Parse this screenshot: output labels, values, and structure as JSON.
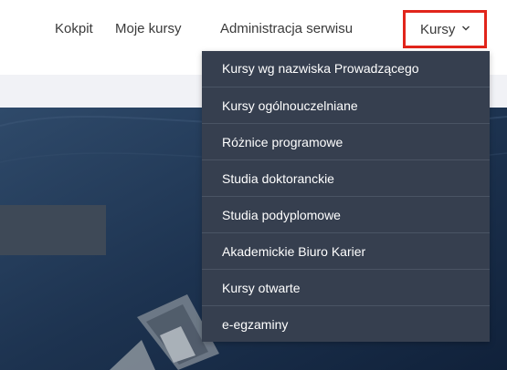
{
  "nav": {
    "items": [
      {
        "label": "Kokpit"
      },
      {
        "label": "Moje kursy"
      },
      {
        "label": "Administracja serwisu"
      }
    ],
    "active": {
      "label": "Kursy"
    }
  },
  "dropdown": {
    "items": [
      {
        "label": "Kursy wg nazwiska Prowadzącego"
      },
      {
        "label": "Kursy ogólnouczelniane"
      },
      {
        "label": "Różnice programowe"
      },
      {
        "label": "Studia doktoranckie"
      },
      {
        "label": "Studia podyplomowe"
      },
      {
        "label": "Akademickie Biuro Karier"
      },
      {
        "label": "Kursy otwarte"
      },
      {
        "label": "e-egzaminy"
      }
    ]
  },
  "colors": {
    "highlight_border": "#e1251b",
    "dropdown_bg": "#363f4f",
    "nav_text": "#3a3a3a"
  }
}
